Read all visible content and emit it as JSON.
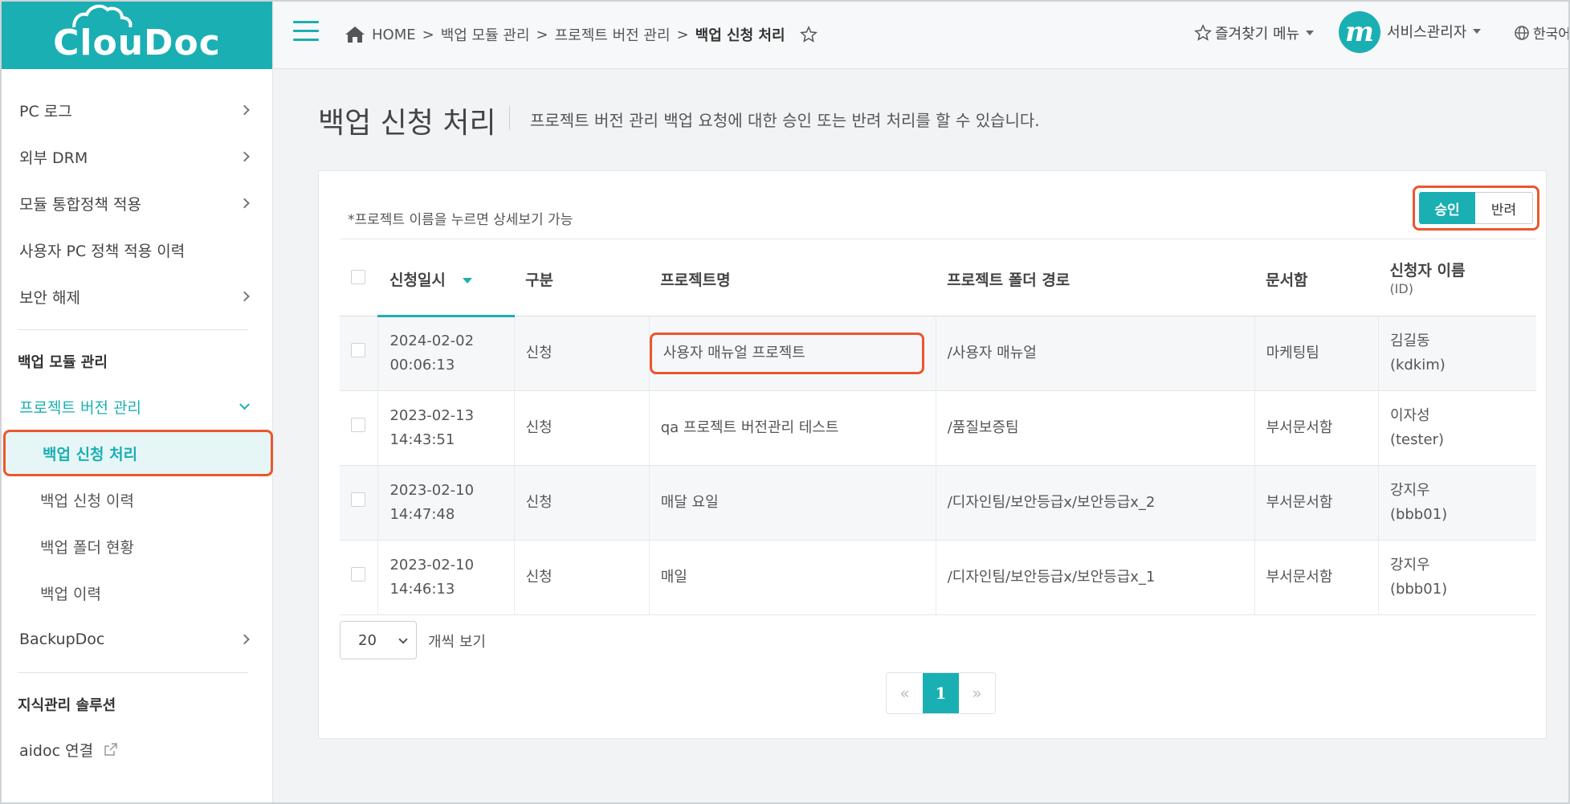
{
  "app": {
    "logo_text": "ClouDoc"
  },
  "breadcrumb": {
    "items": [
      "HOME",
      "백업 모듈 관리",
      "프로젝트 버전 관리"
    ],
    "current": "백업 신청 처리",
    "separator": ">"
  },
  "topbar": {
    "favorites_label": "즐겨찾기 메뉴",
    "avatar_letter": "m",
    "user_label": "서비스관리자",
    "language_label": "한국어"
  },
  "sidebar": {
    "items": [
      {
        "label": "PC 로그"
      },
      {
        "label": "외부 DRM"
      },
      {
        "label": "모듈 통합정책 적용"
      },
      {
        "label": "사용자 PC 정책 적용 이력"
      },
      {
        "label": "보안 해제"
      }
    ],
    "group_backup": "백업 모듈 관리",
    "project_version": "프로젝트 버전 관리",
    "sub_items": [
      {
        "label": "백업 신청 처리"
      },
      {
        "label": "백업 신청 이력"
      },
      {
        "label": "백업 폴더 현황"
      },
      {
        "label": "백업 이력"
      }
    ],
    "backupdoc": "BackupDoc",
    "group_knowledge": "지식관리 솔루션",
    "aidoc": "aidoc 연결"
  },
  "page": {
    "title": "백업 신청 처리",
    "description": "프로젝트 버전 관리 백업 요청에 대한 승인 또는 반려 처리를 할 수 있습니다.",
    "hint": "*프로젝트 이름을 누르면 상세보기 가능"
  },
  "actions": {
    "approve": "승인",
    "reject": "반려"
  },
  "table": {
    "headers": {
      "date": "신청일시",
      "type": "구분",
      "project": "프로젝트명",
      "path": "프로젝트 폴더 경로",
      "docbox": "문서함",
      "applicant": "신청자 이름",
      "applicant_sub": "(ID)"
    },
    "rows": [
      {
        "date": "2024-02-02",
        "time": "00:06:13",
        "type": "신청",
        "project": "사용자 매뉴얼 프로젝트",
        "path": "/사용자 매뉴얼",
        "docbox": "마케팅팀",
        "name": "김길동",
        "id": "(kdkim)"
      },
      {
        "date": "2023-02-13",
        "time": "14:43:51",
        "type": "신청",
        "project": "qa 프로젝트 버전관리 테스트",
        "path": "/품질보증팀",
        "docbox": "부서문서함",
        "name": "이자성",
        "id": "(tester)"
      },
      {
        "date": "2023-02-10",
        "time": "14:47:48",
        "type": "신청",
        "project": "매달 요일",
        "path": "/디자인팀/보안등급x/보안등급x_2",
        "docbox": "부서문서함",
        "name": "강지우",
        "id": "(bbb01)"
      },
      {
        "date": "2023-02-10",
        "time": "14:46:13",
        "type": "신청",
        "project": "매일",
        "path": "/디자인팀/보안등급x/보안등급x_1",
        "docbox": "부서문서함",
        "name": "강지우",
        "id": "(bbb01)"
      }
    ]
  },
  "pagination": {
    "page_size": "20",
    "page_size_label": "개씩 보기",
    "prev": "«",
    "current": "1",
    "next": "»"
  },
  "colors": {
    "accent": "#1aafb3",
    "highlight": "#e9572e"
  }
}
